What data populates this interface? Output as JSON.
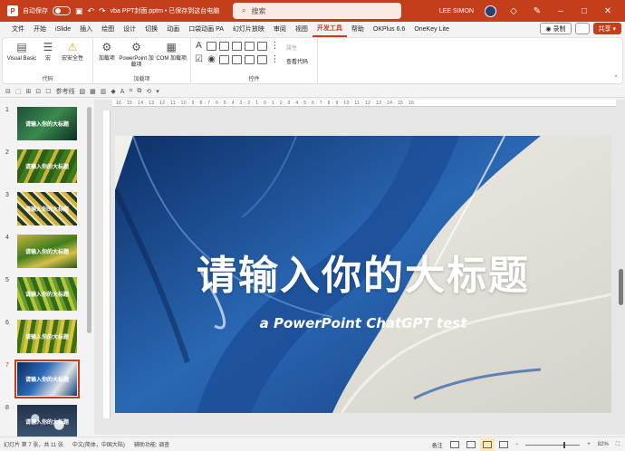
{
  "titlebar": {
    "app_logo": "P",
    "autosave_label": "自动保存",
    "autosave_state": "关",
    "filename": "vba PPT封面.pptm • 已保存到这台电脑",
    "search_placeholder": "搜索",
    "user_name": "LEE SIMON",
    "icons": [
      "save-icon",
      "undo-icon",
      "redo-icon",
      "search-icon",
      "diamond-icon",
      "pen-icon",
      "minimize-icon",
      "maximize-icon",
      "close-icon"
    ]
  },
  "menubar": {
    "tabs": [
      "文件",
      "开始",
      "iSlide",
      "插入",
      "绘图",
      "设计",
      "切换",
      "动画",
      "口袋动画 PA",
      "幻灯片放映",
      "审阅",
      "视图",
      "开发工具",
      "帮助",
      "OKPlus 6.6",
      "OneKey Lite"
    ],
    "active_tab": "开发工具",
    "record_label": "录制",
    "share_label": "共享",
    "accent_color": "#c43e1c"
  },
  "ribbon": {
    "groups": [
      {
        "label": "代码",
        "buttons": [
          "Visual Basic",
          "宏",
          "宏安全性"
        ]
      },
      {
        "label": "加载项",
        "buttons": [
          "加载项",
          "PowerPoint 加载项",
          "COM 加载项"
        ]
      },
      {
        "label": "控件",
        "side_buttons": [
          "属性",
          "查看代码"
        ]
      }
    ]
  },
  "qbar": {
    "reference_label": "参考线"
  },
  "thumbnails": {
    "items": [
      {
        "num": "1",
        "caption": "请输入你的大标题",
        "bg": "linear-gradient(135deg,#1d4d3a,#3a8a4e 50%,#0f2f22)"
      },
      {
        "num": "2",
        "caption": "请输入你的大标题",
        "bg": "repeating-linear-gradient(115deg,#3e7b1c 0 6px,#c9b33a 6px 10px,#2d5f14 10px 16px)"
      },
      {
        "num": "3",
        "caption": "请输入你的大标题",
        "bg": "repeating-linear-gradient(45deg,#d8b23a 0 4px,#1e3a2c 4px 8px,#f1e4b5 8px 10px)"
      },
      {
        "num": "4",
        "caption": "请输入你的大标题",
        "bg": "linear-gradient(160deg,#c9b53d,#3f7d1d 45%,#d4c14a 70%,#2a5a12)"
      },
      {
        "num": "5",
        "caption": "请输入你的大标题",
        "bg": "repeating-linear-gradient(70deg,#2f6b1a 0 5px,#b6c63a 5px 9px,#6a9a2a 9px 13px)"
      },
      {
        "num": "6",
        "caption": "请输入你的大标题",
        "bg": "repeating-linear-gradient(100deg,#d9c43a 0 4px,#3e6f15 4px 9px,#9fb032 9px 12px)"
      },
      {
        "num": "7",
        "caption": "请输入你的大标题",
        "bg": "linear-gradient(125deg,#0d2c5c,#2a6ab8 40%,#dfe3e6 70%,#0e3d7a)",
        "selected": true
      },
      {
        "num": "8",
        "caption": "请输入你的大标题",
        "bg": "radial-gradient(circle at 30% 40%,#c7ced6 0 4px,transparent 5px),radial-gradient(circle at 70% 60%,#dfe4ea 0 5px,transparent 6px),linear-gradient(#23334a,#3c5473)"
      }
    ]
  },
  "ruler": {
    "text": "16 · 15 · 14 · 13 · 12 · 11 · 10 · 9 · 8 · 7 · 6 · 5 · 4 · 3 · 2 · 1 · 0 · 1 · 2 · 3 · 4 · 5 · 6 · 7 · 8 · 9 · 10 · 11 · 12 · 13 · 14 · 15 · 16"
  },
  "slide": {
    "title": "请输入你的大标题",
    "subtitle": "a PowerPoint ChatGPT test"
  },
  "statusbar": {
    "slide_info": "幻灯片 第 7 张，共 11 张",
    "language": "中文(简体，中国大陆)",
    "accessibility": "辅助功能: 调查",
    "notes_label": "备注",
    "zoom": "82%"
  }
}
